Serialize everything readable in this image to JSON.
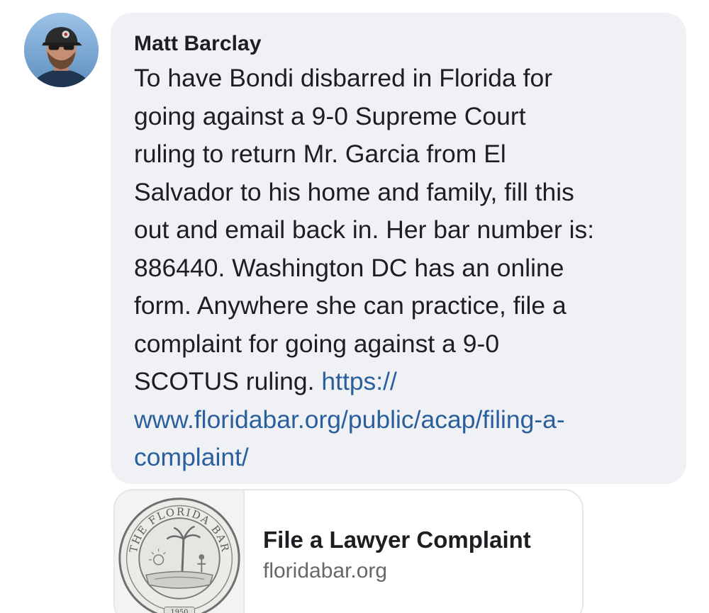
{
  "comment": {
    "author": "Matt Barclay",
    "text_lines": [
      "To have Bondi disbarred in Florida for",
      "going against a 9-0 Supreme Court",
      "ruling to return Mr. Garcia from El",
      "Salvador to his home and family, fill this",
      "out and email back in. Her bar number is:",
      "886440. Washington DC has an online",
      "form. Anywhere she can practice, file a",
      "complaint for going against a 9-0",
      "SCOTUS ruling. "
    ],
    "link_line_1": "https://",
    "link_line_2": "www.floridabar.org/public/acap/filing-a-",
    "link_line_3": "complaint/"
  },
  "link_preview": {
    "title": "File a Lawyer Complaint",
    "domain": "floridabar.org",
    "seal_text_top": "THE FLORIDA BAR",
    "seal_year": "1950"
  },
  "colors": {
    "bubble_bg": "#eff1f4",
    "link": "#2a5f9e",
    "text": "#1c1e21",
    "secondary": "#65676b"
  },
  "icons": {
    "avatar": "profile-photo",
    "seal": "florida-bar-seal"
  }
}
